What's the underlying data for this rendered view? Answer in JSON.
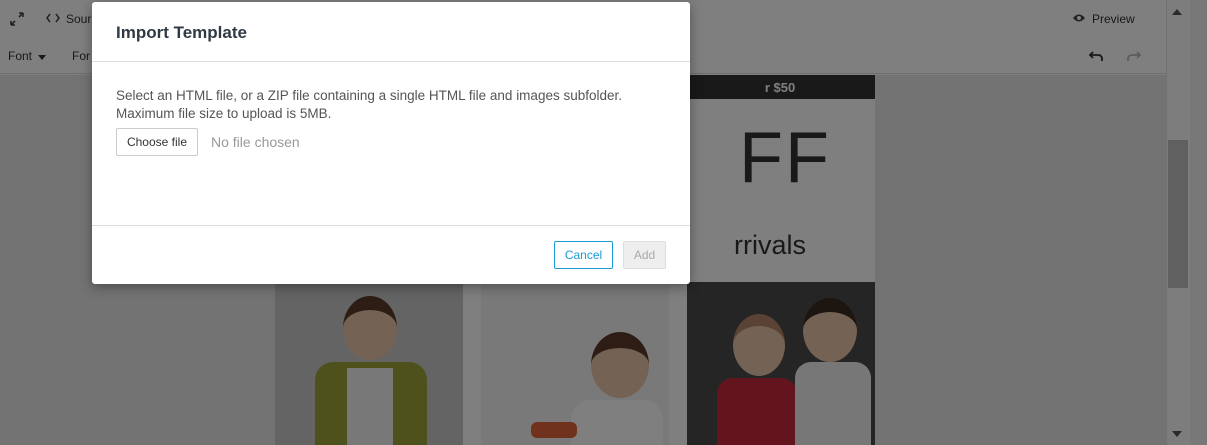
{
  "toolbar": {
    "source_label": "Sour",
    "preview_label": "Preview",
    "font_label": "Font",
    "format_label": "For"
  },
  "email": {
    "promo_text": "r $50",
    "headline": "FF",
    "subheadline": "rrivals"
  },
  "modal": {
    "title": "Import Template",
    "help_text": "Select an HTML file, or a ZIP file containing a single HTML file and images subfolder. Maximum file size to upload is 5MB.",
    "choose_file_label": "Choose file",
    "file_status": "No file chosen",
    "cancel_label": "Cancel",
    "add_label": "Add"
  },
  "colors": {
    "accent": "#1a9bd7",
    "overlay": "rgba(0,0,0,0.5)"
  },
  "icons": {
    "expand": "expand-icon",
    "source": "code-icon",
    "preview": "eye-icon",
    "undo": "undo-icon",
    "redo": "redo-icon"
  }
}
